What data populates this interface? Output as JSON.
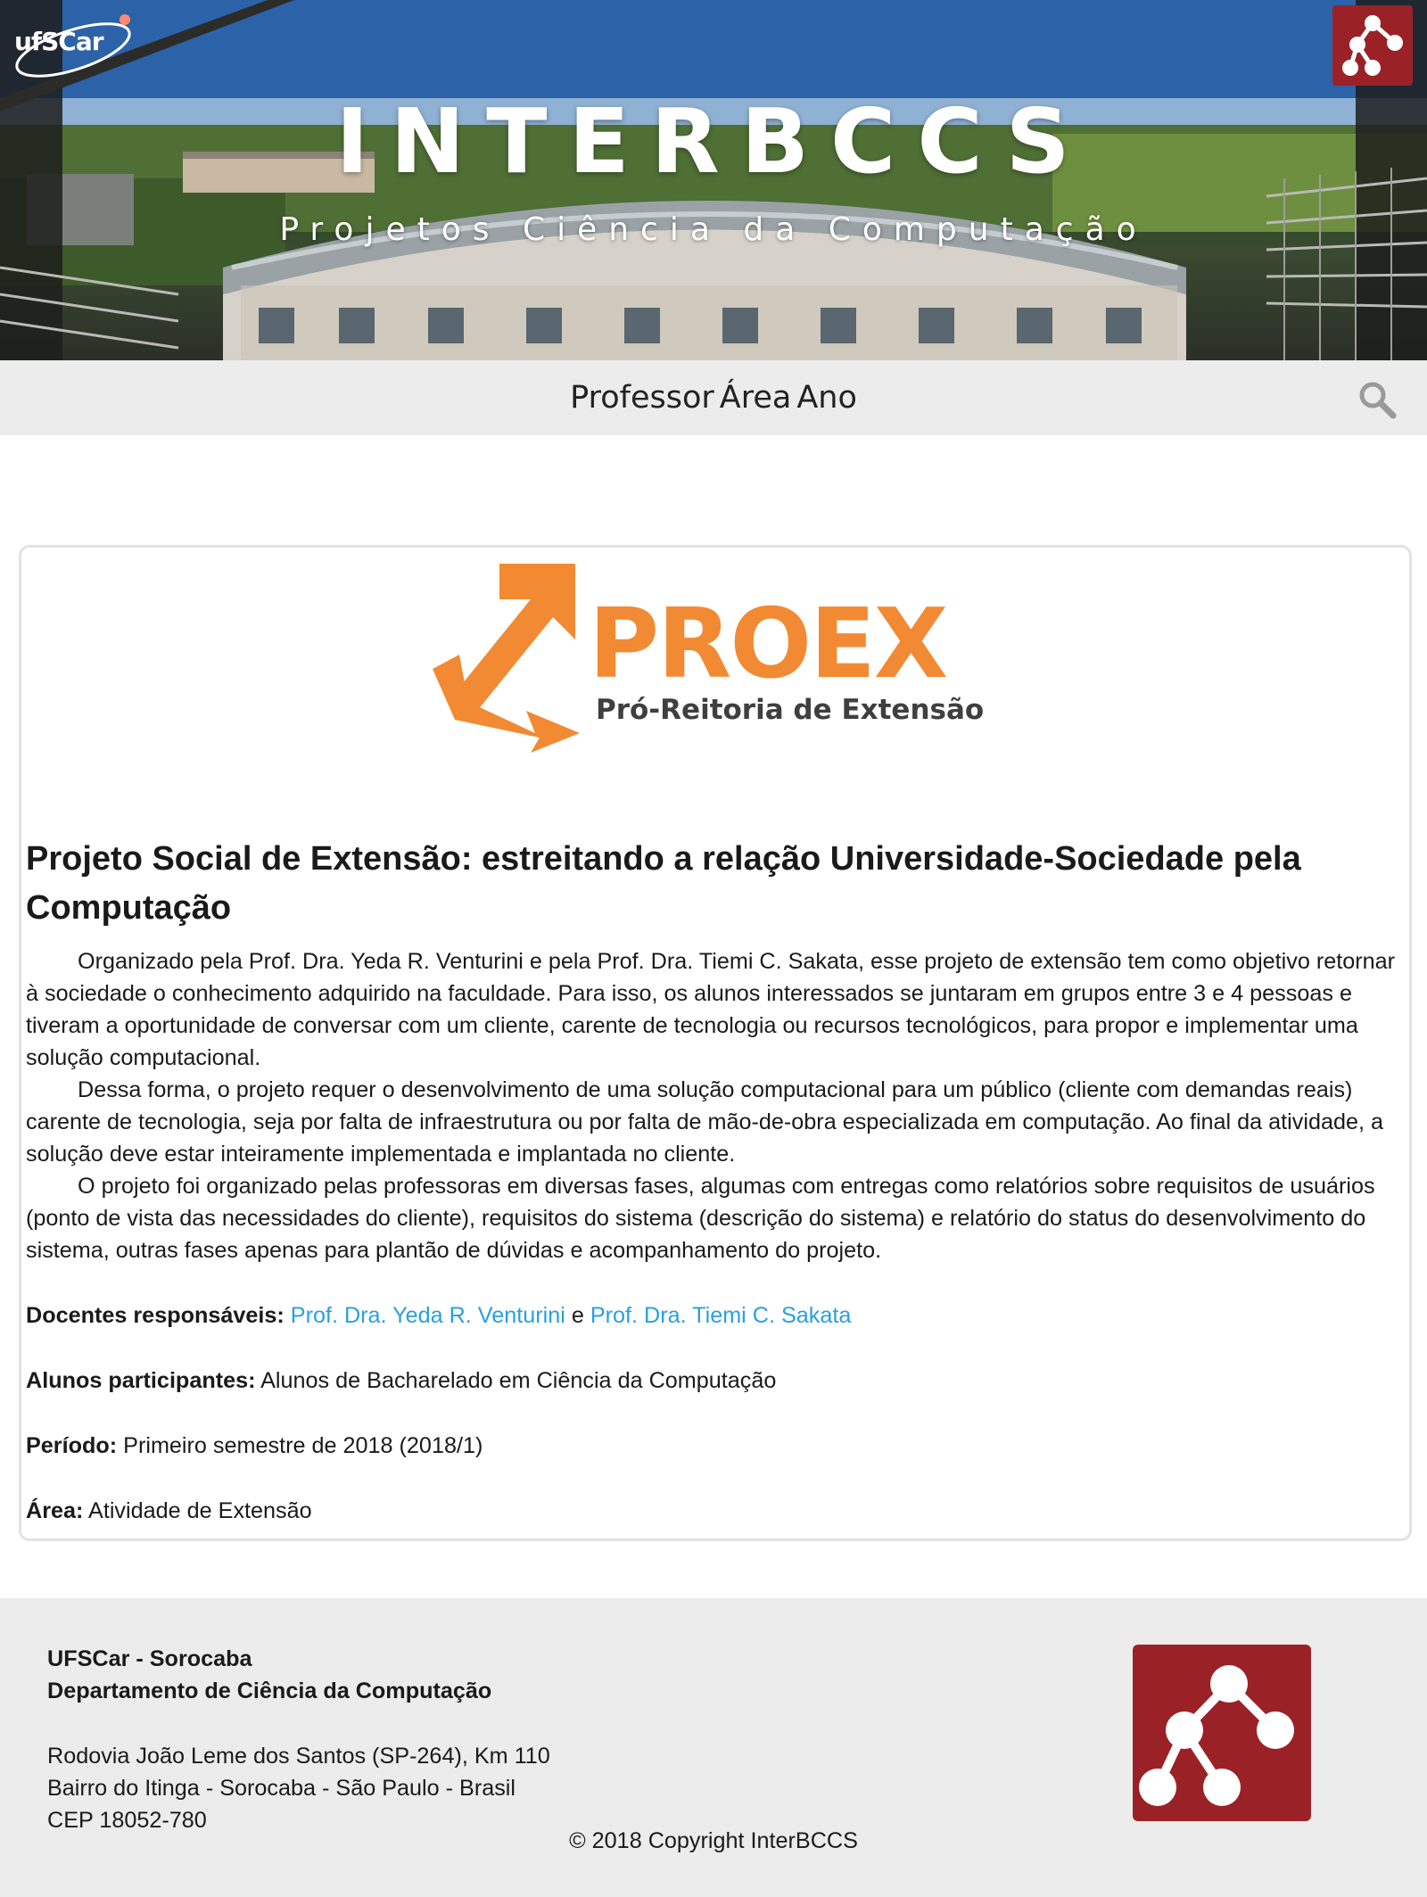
{
  "banner": {
    "title": "INTERBCCS",
    "subtitle": "Projetos Ciência da Computação",
    "ufscar_logo_text": "ufSCar",
    "background_image": "campus-building-panorama"
  },
  "nav": {
    "items": [
      "Professor",
      "Área",
      "Ano"
    ],
    "search_icon": "search-icon"
  },
  "project": {
    "logo": {
      "word": "PROEX",
      "subtitle": "Pró-Reitoria de Extensão",
      "color": "#f28a33"
    },
    "title": "Projeto Social de Extensão: estreitando a relação Universidade-Sociedade pela Computação",
    "paragraphs": [
      "Organizado pela Prof. Dra. Yeda R. Venturini e pela Prof. Dra. Tiemi C. Sakata, esse projeto de extensão tem como objetivo retornar à sociedade o conhecimento adquirido na faculdade. Para isso, os alunos interessados se juntaram em grupos entre 3 e 4 pessoas e tiveram a oportunidade de conversar com um cliente, carente de tecnologia ou recursos tecnológicos, para propor e implementar uma solução computacional.",
      "Dessa forma, o projeto requer o desenvolvimento de uma solução computacional para um público (cliente com demandas reais) carente de tecnologia, seja por falta de infraestrutura ou por falta de mão-de-obra especializada em computação. Ao final da atividade, a solução deve estar inteiramente implementada e implantada no cliente.",
      "O projeto foi organizado pelas professoras em diversas fases, algumas com entregas como relatórios sobre requisitos de usuários (ponto de vista das necessidades do cliente), requisitos do sistema (descrição do sistema) e relatório do status do desenvolvimento do sistema, outras fases apenas para plantão de dúvidas e acompanhamento do projeto."
    ],
    "docentes": {
      "label": "Docentes responsáveis:",
      "teacher1": "Prof. Dra. Yeda R. Venturini",
      "conjunction": "e",
      "teacher2": "Prof. Dra. Tiemi C. Sakata"
    },
    "alunos": {
      "label": "Alunos participantes:",
      "value": "Alunos de Bacharelado em Ciência da Computação"
    },
    "periodo": {
      "label": "Período:",
      "value": "Primeiro semestre de 2018 (2018/1)"
    },
    "area": {
      "label": "Área:",
      "value": "Atividade de Extensão"
    },
    "link_color": "#2a9fe0"
  },
  "footer": {
    "org": "UFSCar - Sorocaba",
    "department": "Departamento de Ciência da Computação",
    "address_line1": "Rodovia João Leme dos Santos (SP-264), Km 110",
    "address_line2": "Bairro do Itinga - Sorocaba - São Paulo - Brasil",
    "address_line3": "CEP 18052-780",
    "copyright": "© 2018 Copyright InterBCCS",
    "logo_color": "#9a2227"
  }
}
